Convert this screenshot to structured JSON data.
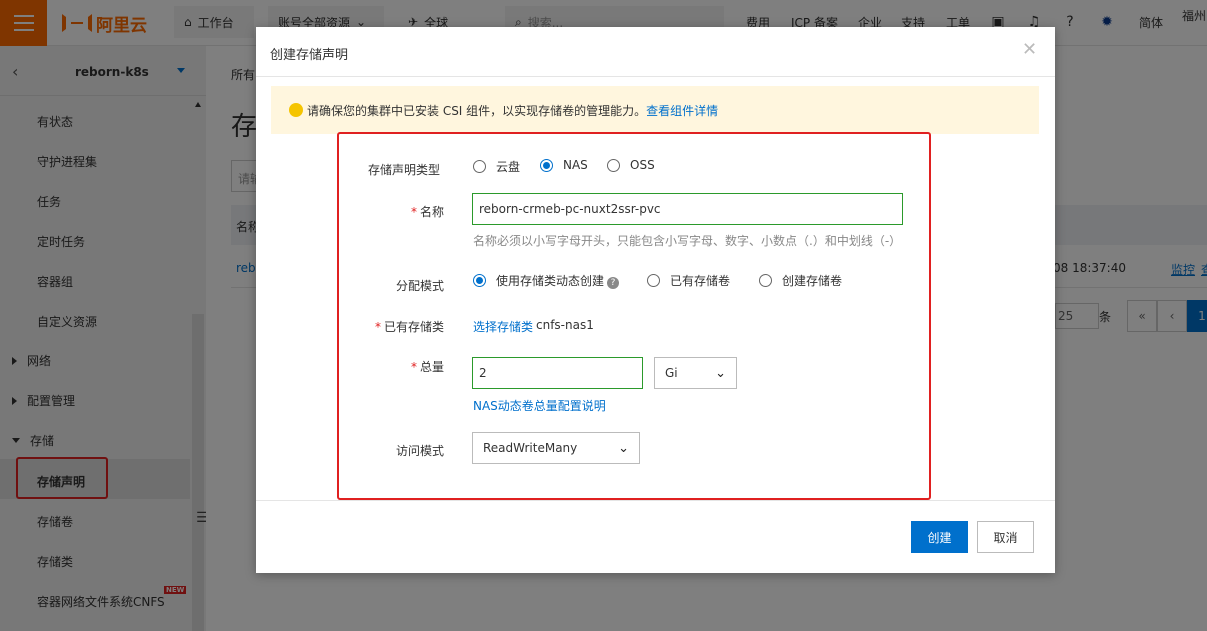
{
  "topbar": {
    "logo_text": "阿里云",
    "workbench": "工作台",
    "resources": "账号全部资源",
    "region": "全球",
    "search_placeholder": "搜索...",
    "menu": [
      "费用",
      "ICP 备案",
      "企业",
      "支持",
      "工单"
    ],
    "language": "简体",
    "city": "福州"
  },
  "sidebar": {
    "cluster": "reborn-k8s",
    "items": [
      "有状态",
      "守护进程集",
      "任务",
      "定时任务",
      "容器组",
      "自定义资源"
    ],
    "groups": [
      "网络",
      "配置管理",
      "存储"
    ],
    "storage_items": [
      "存储声明",
      "存储卷",
      "存储类",
      "容器网络文件系统CNFS"
    ],
    "new_badge": "NEW"
  },
  "background": {
    "breadcrumb": "所有",
    "title": "存",
    "search_text": "请输",
    "table_header": "名称",
    "row_name": "rebo",
    "row_date": "08 18:37:40",
    "row_links": [
      "监控",
      "查"
    ],
    "page_size": "25",
    "page_unit": "条",
    "pager": [
      "«",
      "‹",
      "1"
    ]
  },
  "modal": {
    "title": "创建存储声明",
    "notice": "请确保您的集群中已安装 CSI 组件，以实现存储卷的管理能力。",
    "notice_link": "查看组件详情",
    "type_label": "存储声明类型",
    "type_options": [
      "云盘",
      "NAS",
      "OSS"
    ],
    "type_selected": "NAS",
    "name_label": "名称",
    "name_value": "reborn-crmeb-pc-nuxt2ssr-pvc",
    "name_hint": "名称必须以小写字母开头，只能包含小写字母、数字、小数点（.）和中划线（-）",
    "alloc_label": "分配模式",
    "alloc_options": [
      "使用存储类动态创建",
      "已有存储卷",
      "创建存储卷"
    ],
    "alloc_selected": "使用存储类动态创建",
    "storage_class_label": "已有存储类",
    "storage_class_link": "选择存储类",
    "storage_class_value": "cnfs-nas1",
    "total_label": "总量",
    "total_value": "2",
    "total_unit": "Gi",
    "total_help_link": "NAS动态卷总量配置说明",
    "access_label": "访问模式",
    "access_value": "ReadWriteMany",
    "create_button": "创建",
    "cancel_button": "取消"
  }
}
